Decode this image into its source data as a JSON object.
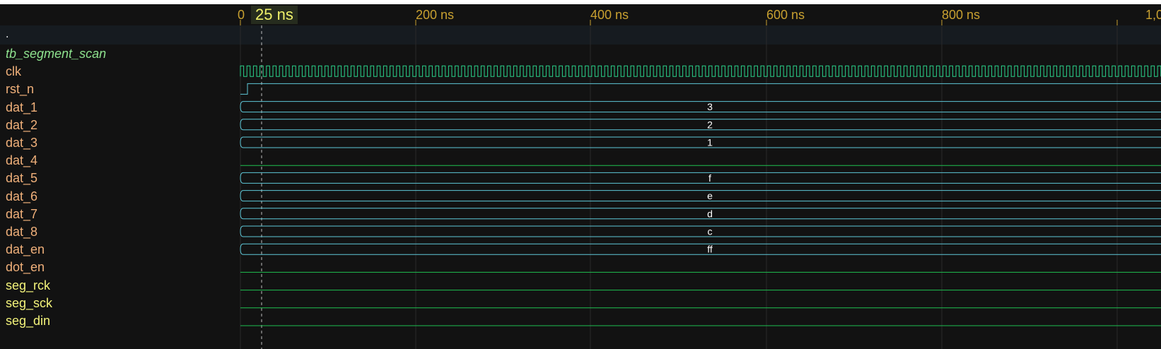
{
  "timeline": {
    "cursor_label": "25 ns",
    "zero_label": "0",
    "tick_labels": [
      "200 ns",
      "400 ns",
      "600 ns",
      "800 ns",
      "1,0"
    ],
    "scope_dot": "."
  },
  "signals": [
    {
      "name": "tb_segment_scan",
      "kind": "scope"
    },
    {
      "name": "clk",
      "kind": "input",
      "wave": "clock"
    },
    {
      "name": "rst_n",
      "kind": "input",
      "wave": "step"
    },
    {
      "name": "dat_1",
      "kind": "input",
      "wave": "bus",
      "value": "3"
    },
    {
      "name": "dat_2",
      "kind": "input",
      "wave": "bus",
      "value": "2"
    },
    {
      "name": "dat_3",
      "kind": "input",
      "wave": "bus",
      "value": "1"
    },
    {
      "name": "dat_4",
      "kind": "input",
      "wave": "low"
    },
    {
      "name": "dat_5",
      "kind": "input",
      "wave": "bus",
      "value": "f"
    },
    {
      "name": "dat_6",
      "kind": "input",
      "wave": "bus",
      "value": "e"
    },
    {
      "name": "dat_7",
      "kind": "input",
      "wave": "bus",
      "value": "d"
    },
    {
      "name": "dat_8",
      "kind": "input",
      "wave": "bus",
      "value": "c"
    },
    {
      "name": "dat_en",
      "kind": "input",
      "wave": "bus",
      "value": "ff"
    },
    {
      "name": "dot_en",
      "kind": "input",
      "wave": "low"
    },
    {
      "name": "seg_rck",
      "kind": "output",
      "wave": "low"
    },
    {
      "name": "seg_sck",
      "kind": "output",
      "wave": "low"
    },
    {
      "name": "seg_din",
      "kind": "output",
      "wave": "low"
    }
  ],
  "colors": {
    "bus": "#5ec8d8",
    "clock": "#2ad28a",
    "low": "#1fbf50",
    "ruler_text": "#c8a030",
    "cursor_badge_text": "#eef06a"
  }
}
